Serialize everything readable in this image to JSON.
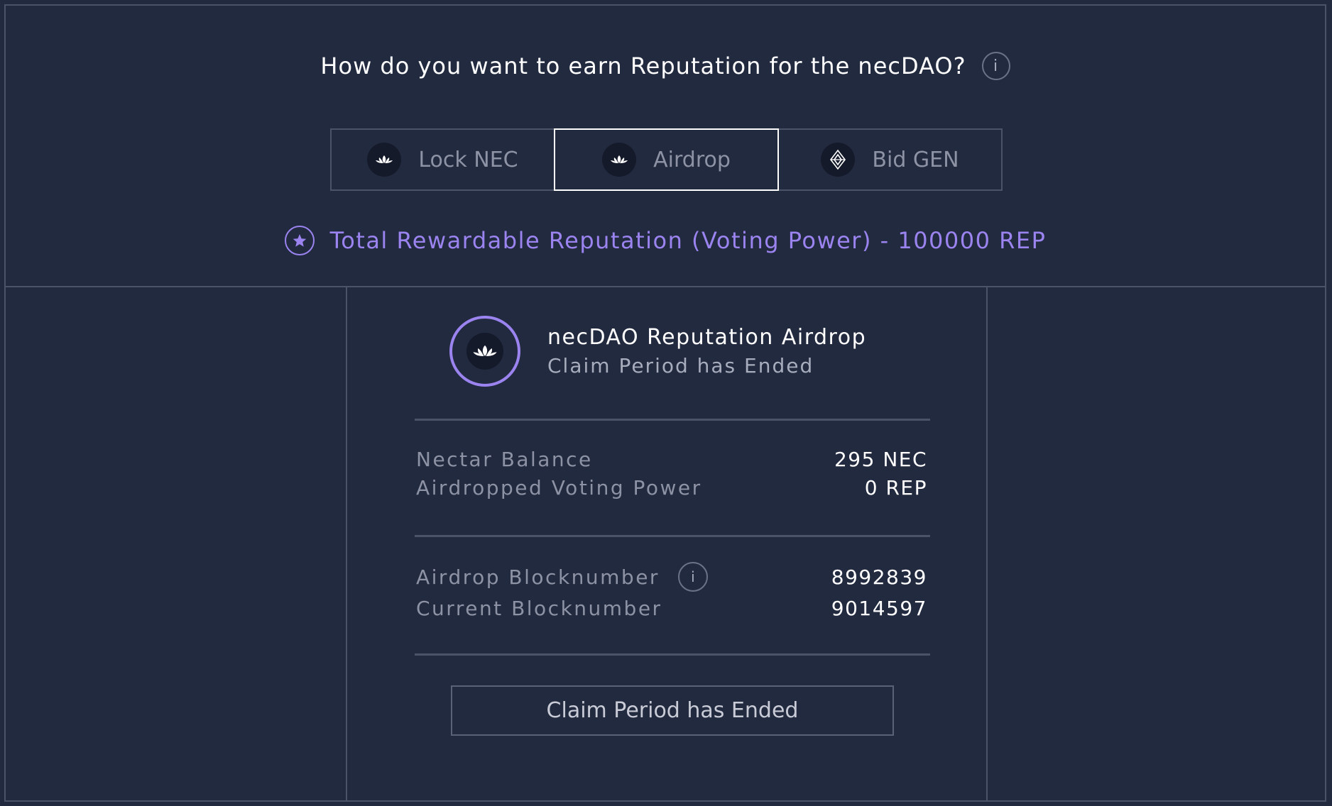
{
  "header": {
    "question": "How do you want to earn Reputation for the necDAO?",
    "info_label": "i"
  },
  "tabs": [
    {
      "label": "Lock NEC",
      "icon": "lotus-icon",
      "active": false
    },
    {
      "label": "Airdrop",
      "icon": "lotus-icon",
      "active": true
    },
    {
      "label": "Bid GEN",
      "icon": "gen-diamond-icon",
      "active": false
    }
  ],
  "total_reputation": {
    "text": "Total Rewardable Reputation (Voting Power) - 100000 REP",
    "icon": "star-icon"
  },
  "airdrop": {
    "title": "necDAO Reputation Airdrop",
    "subtitle": "Claim Period has Ended",
    "nectar_balance_label": "Nectar Balance",
    "nectar_balance_value": "295 NEC",
    "voting_power_label": "Airdropped Voting Power",
    "voting_power_value": "0 REP",
    "airdrop_block_label": "Airdrop Blocknumber",
    "airdrop_block_value": "8992839",
    "current_block_label": "Current Blocknumber",
    "current_block_value": "9014597",
    "info_label": "i",
    "button_label": "Claim Period has Ended"
  },
  "colors": {
    "background": "#222a40",
    "border": "#4b5369",
    "accent": "#9b84f0",
    "text": "#ffffff",
    "muted": "#8d93a4"
  }
}
